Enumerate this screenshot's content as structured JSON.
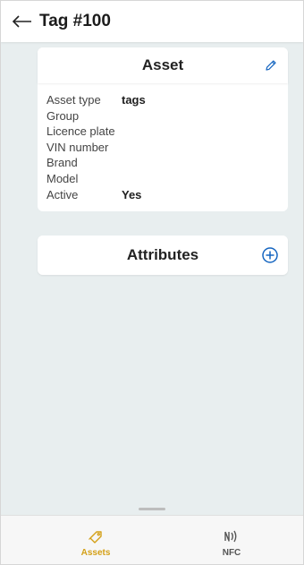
{
  "header": {
    "title": "Tag #100",
    "back_icon": "arrow-left-icon"
  },
  "asset_card": {
    "title": "Asset",
    "edit_icon": "pencil-icon",
    "properties": [
      {
        "label": "Asset type",
        "value": "tags"
      },
      {
        "label": "Group",
        "value": ""
      },
      {
        "label": "Licence plate",
        "value": ""
      },
      {
        "label": "VIN number",
        "value": ""
      },
      {
        "label": "Brand",
        "value": ""
      },
      {
        "label": "Model",
        "value": ""
      },
      {
        "label": "Active",
        "value": "Yes"
      }
    ]
  },
  "attributes_card": {
    "title": "Attributes",
    "add_icon": "plus-circle-icon"
  },
  "bottom_nav": {
    "items": [
      {
        "label": "Assets",
        "icon": "tag-icon",
        "active": true
      },
      {
        "label": "NFC",
        "icon": "nfc-icon",
        "active": false
      }
    ]
  },
  "colors": {
    "accent": "#d4a017",
    "add_icon": "#1565c0",
    "edit_icon": "#1565c0",
    "inactive_nav": "#555555",
    "background": "#e8eeef"
  }
}
